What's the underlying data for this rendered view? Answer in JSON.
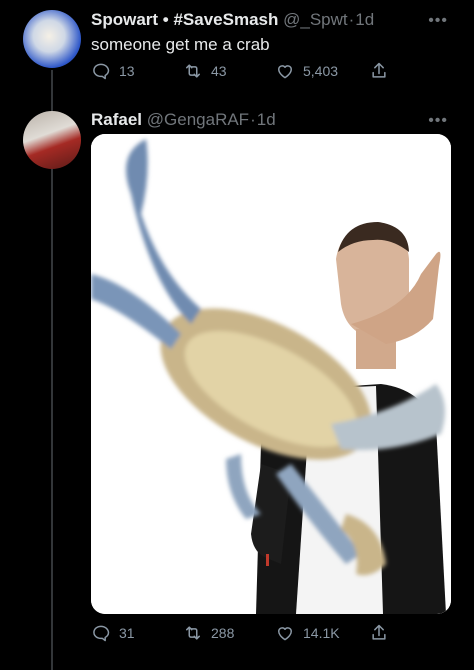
{
  "tweet1": {
    "display_name": "Spowart • #SaveSmash",
    "handle": "@_Spwt",
    "time": "1d",
    "text": "someone get me a crab",
    "replies": "13",
    "retweets": "43",
    "likes": "5,403"
  },
  "tweet2": {
    "display_name": "Rafael",
    "handle": "@GengaRAF",
    "time": "1d",
    "replies": "31",
    "retweets": "288",
    "likes": "14.1K"
  },
  "ui": {
    "more": "•••",
    "separator": "·"
  }
}
